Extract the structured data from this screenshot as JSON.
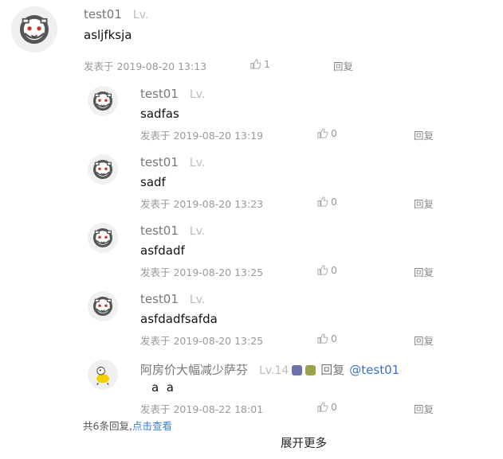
{
  "top_comment": {
    "username": "test01",
    "level": "Lv.",
    "content": "asljfksja",
    "time": "发表于 2019-08-20 13:13",
    "likes": "1",
    "reply_label": "回复"
  },
  "replies": [
    {
      "username": "test01",
      "level": "Lv.",
      "content": "sadfas",
      "time": "发表于 2019-08-20 13:19",
      "likes": "0",
      "reply_label": "回复"
    },
    {
      "username": "test01",
      "level": "Lv.",
      "content": "sadf",
      "time": "发表于 2019-08-20 13:23",
      "likes": "0",
      "reply_label": "回复"
    },
    {
      "username": "test01",
      "level": "Lv.",
      "content": "asfdadf",
      "time": "发表于 2019-08-20 13:25",
      "likes": "0",
      "reply_label": "回复"
    },
    {
      "username": "test01",
      "level": "Lv.",
      "content": "asfdadfsafda",
      "time": "发表于 2019-08-20 13:25",
      "likes": "0",
      "reply_label": "回复"
    },
    {
      "username": "阿房价大幅减少萨芬",
      "level": "Lv.14",
      "inline_reply": "回复",
      "mention": "@test01",
      "content": "a  a",
      "time": "发表于 2019-08-22 18:01",
      "likes": "0",
      "reply_label": "回复"
    }
  ],
  "summary": {
    "text": "共6条回复,",
    "link": "点击查看"
  },
  "expand_more": "展开更多",
  "colors": {
    "mention": "#3a6fd1",
    "meta": "#999999"
  }
}
